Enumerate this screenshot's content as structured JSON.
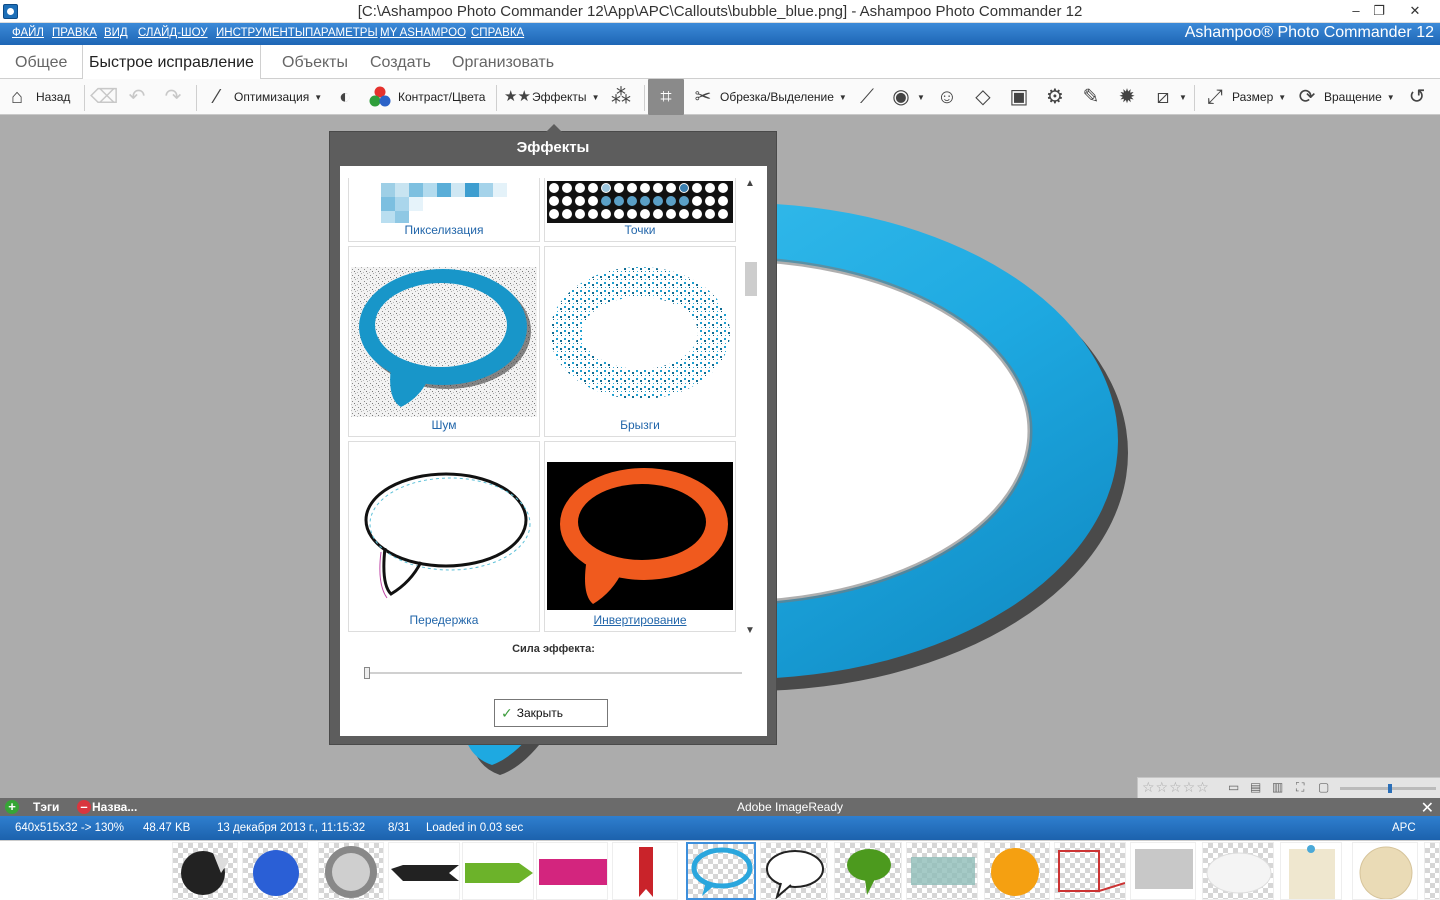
{
  "window": {
    "title": "[C:\\Ashampoo Photo Commander 12\\App\\APC\\Callouts\\bubble_blue.png] - Ashampoo Photo Commander 12",
    "controls": [
      "–",
      "❐",
      "✕"
    ]
  },
  "menu": {
    "items": [
      "ФАЙЛ",
      "ПРАВКА",
      "ВИД",
      "СЛАЙД-ШОУ",
      "ИНСТРУМЕНТЫ",
      "ПАРАМЕТРЫ",
      "MY ASHAMPOO",
      "СПРАВКА"
    ],
    "brand": "Ashampoo® Photo Commander 12"
  },
  "tabs": [
    "Общее",
    "Быстрое исправление",
    "Объекты",
    "Создать",
    "Организовать"
  ],
  "active_tab": "Быстрое исправление",
  "toolbar": {
    "back": "Назад",
    "optimize": "Оптимизация",
    "contrast": "Контраст/Цвета",
    "effects": "Эффекты",
    "crop": "Обрезка/Выделение",
    "size": "Размер",
    "rotate": "Вращение"
  },
  "dialog": {
    "title": "Эффекты",
    "effects": [
      {
        "label": "Пикселизация"
      },
      {
        "label": "Точки"
      },
      {
        "label": "Шум"
      },
      {
        "label": "Брызги"
      },
      {
        "label": "Передержка"
      },
      {
        "label": "Инвертирование"
      }
    ],
    "strength_label": "Сила эффекта:",
    "strength_value": 0,
    "close_label": "Закрыть"
  },
  "bottom_bar": {
    "tags": "Тэги",
    "names": "Назва...",
    "center_title": "Adobe ImageReady"
  },
  "status": {
    "dimensions": "640x515x32 -> 130%",
    "size": "48.47 KB",
    "date": "13 декабря 2013 г., 11:15:32",
    "index": "8/31",
    "load": "Loaded in 0.03 sec",
    "app": "APC"
  },
  "colors": {
    "accent": "#1e66b5",
    "bubble_blue": "#1ea9e1",
    "link": "#2266aa",
    "dialog_bg": "#5d5d5d"
  }
}
